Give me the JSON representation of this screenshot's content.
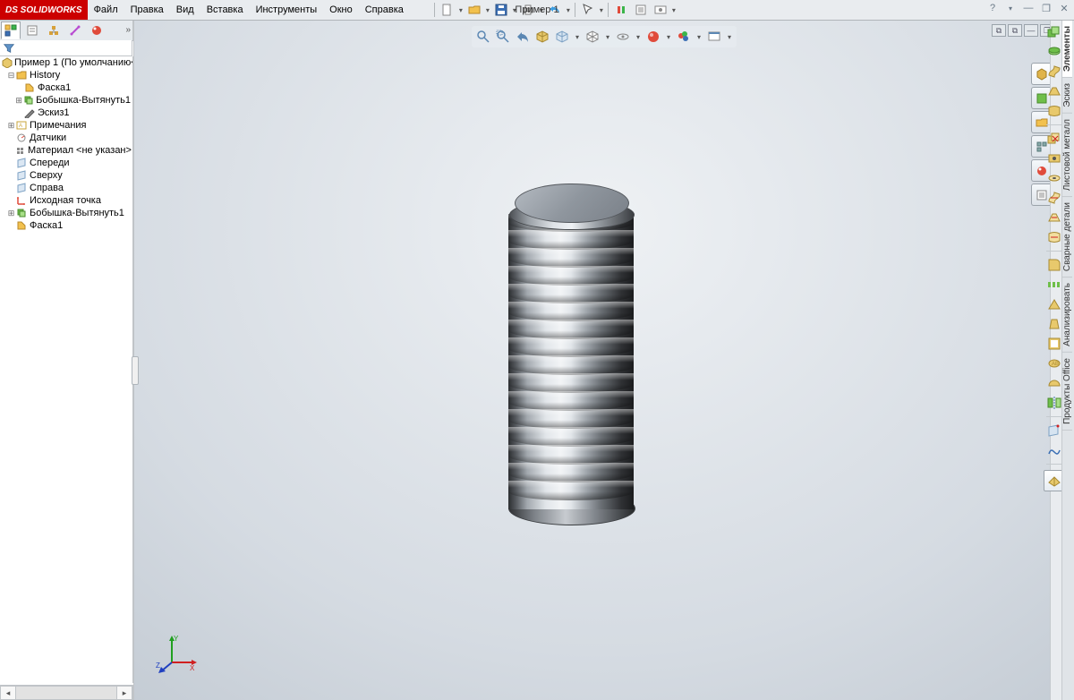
{
  "app": {
    "name": "SOLIDWORKS",
    "document_title": "Пример 1"
  },
  "menu": {
    "file": "Файл",
    "edit": "Правка",
    "view": "Вид",
    "insert": "Вставка",
    "tools": "Инструменты",
    "window": "Окно",
    "help": "Справка"
  },
  "tree": {
    "root": "Пример 1  (По умолчанию<",
    "history": "History",
    "history_items": [
      "Фаска1",
      "Бобышка-Вытянуть1",
      "Эскиз1"
    ],
    "annotations": "Примечания",
    "sensors": "Датчики",
    "material": "Материал <не указан>",
    "front": "Спереди",
    "top": "Сверху",
    "right": "Справа",
    "origin": "Исходная точка",
    "feature1": "Бобышка-Вытянуть1",
    "feature2": "Фаска1"
  },
  "cmd_tabs": {
    "t1": "Элементы",
    "t2": "Эскиз",
    "t3": "Листовой металл",
    "t4": "Сварные детали",
    "t5": "Анализировать",
    "t6": "Продукты Office"
  },
  "triad": {
    "x": "X",
    "y": "Y",
    "z": "Z"
  }
}
